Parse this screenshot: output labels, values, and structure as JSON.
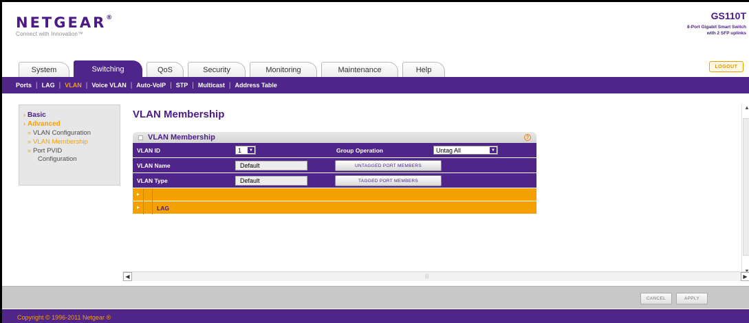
{
  "header": {
    "brand": "NETGEAR",
    "brand_mark": "®",
    "tagline": "Connect with Innovation™",
    "model_name": "GS110T",
    "model_desc_1": "8-Port Gigabit Smart Switch",
    "model_desc_2": "with 2 SFP uplinks",
    "logout_label": "LOGOUT"
  },
  "tabs": [
    {
      "label": "System",
      "active": false
    },
    {
      "label": "Switching",
      "active": true
    },
    {
      "label": "QoS",
      "active": false
    },
    {
      "label": "Security",
      "active": false
    },
    {
      "label": "Monitoring",
      "active": false
    },
    {
      "label": "Maintenance",
      "active": false
    },
    {
      "label": "Help",
      "active": false
    }
  ],
  "subnav": [
    {
      "label": "Ports",
      "active": false
    },
    {
      "label": "LAG",
      "active": false
    },
    {
      "label": "VLAN",
      "active": true
    },
    {
      "label": "Voice VLAN",
      "active": false
    },
    {
      "label": "Auto-VoIP",
      "active": false
    },
    {
      "label": "STP",
      "active": false
    },
    {
      "label": "Multicast",
      "active": false
    },
    {
      "label": "Address Table",
      "active": false
    }
  ],
  "leftmenu": {
    "basic": "Basic",
    "advanced": "Advanced",
    "items": [
      {
        "label": "VLAN Configuration",
        "active": false
      },
      {
        "label": "VLAN Membership",
        "active": true
      },
      {
        "label": "Port PVID",
        "active": false
      }
    ],
    "port_pvid_cont": "Configuration"
  },
  "main": {
    "page_title": "VLAN Membership",
    "panel_title": "VLAN Membership",
    "help_icon_glyph": "?",
    "vlan_id_label": "VLAN ID",
    "vlan_id_value": "1",
    "group_operation_label": "Group Operation",
    "group_operation_value": "Untag All",
    "vlan_name_label": "VLAN Name",
    "vlan_name_value": "Default",
    "untagged_button": "UNTAGGED PORT MEMBERS",
    "vlan_type_label": "VLAN Type",
    "vlan_type_value": "Default",
    "tagged_button": "TAGGED PORT MEMBERS",
    "row1_label": "",
    "lag_label": "LAG"
  },
  "footer": {
    "cancel_label": "CANCEL",
    "apply_label": "APPLY",
    "copyright": "Copyright © 1996-2011 Netgear ®"
  },
  "colors": {
    "purple": "#4f2589",
    "orange": "#f4a100",
    "gray": "#c8c8c8"
  }
}
